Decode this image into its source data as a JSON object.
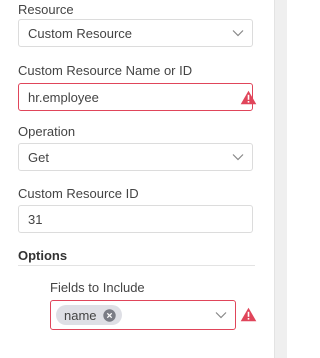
{
  "resource": {
    "label": "Resource",
    "value": "Custom Resource"
  },
  "custom_resource_name": {
    "label": "Custom Resource Name or ID",
    "value": "hr.employee"
  },
  "operation": {
    "label": "Operation",
    "value": "Get"
  },
  "custom_resource_id": {
    "label": "Custom Resource ID",
    "value": "31"
  },
  "options": {
    "heading": "Options",
    "fields_to_include": {
      "label": "Fields to Include",
      "chips": [
        "name"
      ]
    }
  },
  "colors": {
    "error": "#e0455a",
    "warning": "#e0455a",
    "chip_bg": "#dedfe5"
  }
}
